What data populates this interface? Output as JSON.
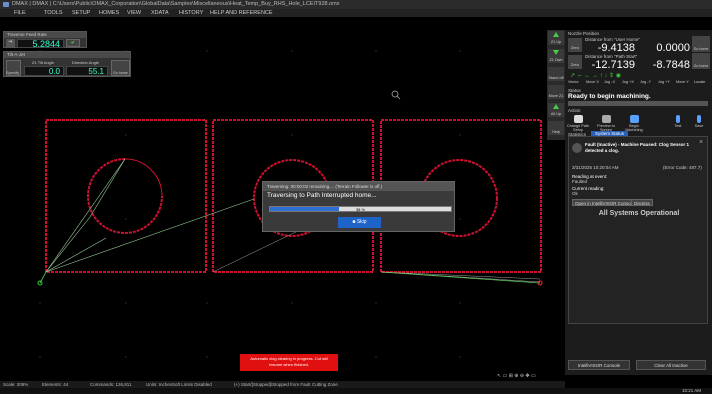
{
  "window": {
    "title": "DMAX | DMAX | C:\\Users\\Public\\OMAX_Corporation\\GlobalData\\Samples\\Miscellaneous\\Heat_Temp_Buy_RHS_Hole_LCEIT928.omx"
  },
  "menu": [
    "FILE",
    "TOOLS",
    "SETUP",
    "HOMES",
    "VIEW",
    "XDATA",
    "HISTORY",
    "HELP AND REFERENCE"
  ],
  "feed_panel": {
    "title": "Traverse Feed Rate",
    "value": "5.2844"
  },
  "tilt_panel": {
    "title": "Tilt-A-Jet",
    "label1": "Z1 Tilt Angle",
    "label2": "Direction Angle",
    "value1": "0.0",
    "value2": "55.1",
    "specify": "Specify",
    "go_home": "Go home"
  },
  "side_buttons": [
    "Z1 Up",
    "Z1 Dwn",
    "Stand off",
    "Move Z1",
    "All Up",
    "Help"
  ],
  "nozzle": {
    "title": "Nozzle Position",
    "d1_label": "Distance from \"User Home\"",
    "d2_label": "Distance from \"Path Start\"",
    "x1": "-9.4138",
    "y1": "0.0000",
    "x2": "-12.7139",
    "y2": "-8.7848",
    "zero": "Zero",
    "go_home": "Go home",
    "go_home2": "Go home"
  },
  "jog": [
    "Vector",
    "Move X",
    "Jog -X",
    "Jog +X",
    "Jog -Y",
    "Jog +Y",
    "Move Y",
    "Locate"
  ],
  "status": {
    "label": "Status",
    "text": "Ready to begin machining."
  },
  "action": {
    "label": "Action"
  },
  "toolbar": [
    "Change Path Setup",
    "Preview to Screen",
    "Begin Machining",
    "Test",
    "Save"
  ],
  "tabs": [
    "Statistics",
    "System Status"
  ],
  "notice": {
    "title": "Fault (Inactive) - Machine Paused: Clog Sensor 1 detected a clog.",
    "date": "3/31/2025 10:20:04 AM",
    "code": "(Error Code: 487.7)",
    "reading_label": "Reading at event:",
    "reading_value": "Faulted",
    "current_label": "Current reading:",
    "current_value": "Ok",
    "btn1": "Open in IntelliVISOR Console",
    "btn2": "Dismiss",
    "systems": "All Systems Operational"
  },
  "bottom_buttons": [
    "IntelliVISOR Console",
    "Clear All Inactive"
  ],
  "dialog": {
    "header": "Traversing: 00:00:02 remaining....  (Terrain Follower is off.)",
    "message": "Traversing to Path Interrupted home...",
    "percent": "38 %",
    "progress": 0.38,
    "skip": "Skip"
  },
  "banner": {
    "line1": "Automatic clog clearing in progress. Cut will",
    "line2": "resume when finished."
  },
  "statusbar": [
    "Scale: 209%",
    "Elements: 44",
    "Commands: 126,811",
    "Units: Inches",
    "Soft Limits Disabled",
    "(+) Start/[Stopped]/Stopped from Fault",
    "Cutting Zone"
  ],
  "clock": "10:21 AM"
}
